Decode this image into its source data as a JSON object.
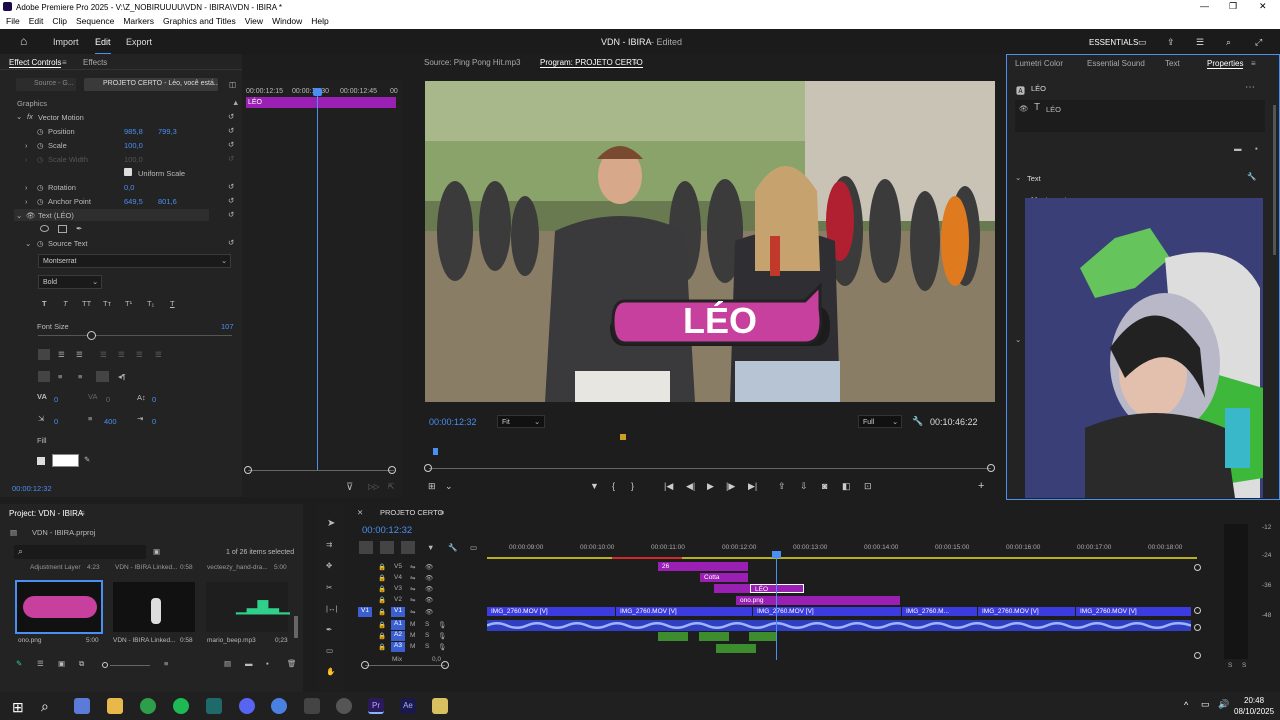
{
  "window": {
    "title": "Adobe Premiere Pro 2025 - V:\\Z_NOBIRUUUU\\VDN - IBIRA\\VDN - IBIRA *"
  },
  "menu": [
    "File",
    "Edit",
    "Clip",
    "Sequence",
    "Markers",
    "Graphics and Titles",
    "View",
    "Window",
    "Help"
  ],
  "topbar": {
    "import": "Import",
    "edit": "Edit",
    "export": "Export",
    "project_title": "VDN - IBIRA",
    "status": "- Edited",
    "workspace": "ESSENTIALS"
  },
  "effect_controls": {
    "tab1": "Effect Controls",
    "tab2": "Effects",
    "source_dropdown": "Source - G...",
    "sequence_dropdown": "PROJETO CERTO - Léo, você está...",
    "times": [
      "00:00:12:15",
      "00:00:12:30",
      "00:00:12:45",
      "00"
    ],
    "clip_label": "LÉO",
    "section": "Graphics",
    "vector_motion": "Vector Motion",
    "position_label": "Position",
    "position_x": "985,8",
    "position_y": "799,3",
    "scale_label": "Scale",
    "scale_val": "100,0",
    "scale_width_label": "Scale Width",
    "scale_width_val": "100,0",
    "uniform_scale": "Uniform Scale",
    "rotation_label": "Rotation",
    "rotation_val": "0,0",
    "anchor_label": "Anchor Point",
    "anchor_x": "649,5",
    "anchor_y": "801,6",
    "text_layer": "Text (LÉO)",
    "source_text": "Source Text",
    "font": "Montserrat",
    "style": "Bold",
    "font_size_label": "Font Size",
    "font_size_val": "107",
    "kerning": "0",
    "tracking": "0",
    "leading": "400",
    "baseline": "0",
    "tsume": "0",
    "fill_label": "Fill",
    "timecode": "00:00:12:32"
  },
  "monitor": {
    "source_tab": "Source: Ping Pong Hit.mp3",
    "program_tab": "Program: PROJETO CERTO",
    "overlay_text": "LÉO",
    "timecode": "00:00:12:32",
    "fit": "Fit",
    "quality": "Full",
    "duration": "00:10:46:22"
  },
  "right_panel": {
    "tabs": [
      "Lumetri Color",
      "Essential Sound",
      "Text",
      "Properties"
    ],
    "layer_group": "LÉO",
    "layer_item": "LÉO",
    "text_section": "Text",
    "font": "Montserrat"
  },
  "project": {
    "title": "Project: VDN - IBIRA",
    "file": "VDN - IBIRA.prproj",
    "selected": "1 of 26 items selected",
    "top_items": [
      {
        "name": "Adjustment Layer",
        "dur": "4:23"
      },
      {
        "name": "VDN - IBIRA Linked...",
        "dur": "0:58"
      },
      {
        "name": "vecteezy_hand-dra...",
        "dur": "5:00"
      }
    ],
    "items": [
      {
        "name": "ono.png",
        "dur": "5:00"
      },
      {
        "name": "VDN - IBIRA Linked...",
        "dur": "0:58"
      },
      {
        "name": "mario_beep.mp3",
        "dur": "0;23"
      }
    ]
  },
  "timeline": {
    "title": "PROJETO CERTO",
    "timecode": "00:00:12:32",
    "ruler": [
      "00:00:09:00",
      "00:00:10:00",
      "00:00:11:00",
      "00:00:12:00",
      "00:00:13:00",
      "00:00:14:00",
      "00:00:15:00",
      "00:00:16:00",
      "00:00:17:00",
      "00:00:18:00"
    ],
    "tracks": [
      "V5",
      "V4",
      "V3",
      "V2",
      "V1",
      "A1",
      "A2",
      "A3",
      "Mix"
    ],
    "v5_clip": "26",
    "v4_clip": "Cotta",
    "v3_clip": "LÉO",
    "v2_clip": "ono.png",
    "v1_clips": [
      "IMG_2760.MOV [V]",
      "IMG_2760.MOV [V]",
      "IMG_2760.MOV [V]",
      "IMG_2760.M...",
      "IMG_2760.MOV [V]",
      "IMG_2760.MOV [V]"
    ],
    "mix_val": "0,0",
    "meter": [
      "-12",
      "-24",
      "-36",
      "-48"
    ],
    "meter_s": "S"
  },
  "taskbar": {
    "time": "20:48",
    "date": "08/10/2025"
  },
  "colors": {
    "accent": "#4a8ff2",
    "clip_purple": "#9a1fb3",
    "clip_blue": "#3b3be0",
    "bubble": "#c7409e"
  }
}
